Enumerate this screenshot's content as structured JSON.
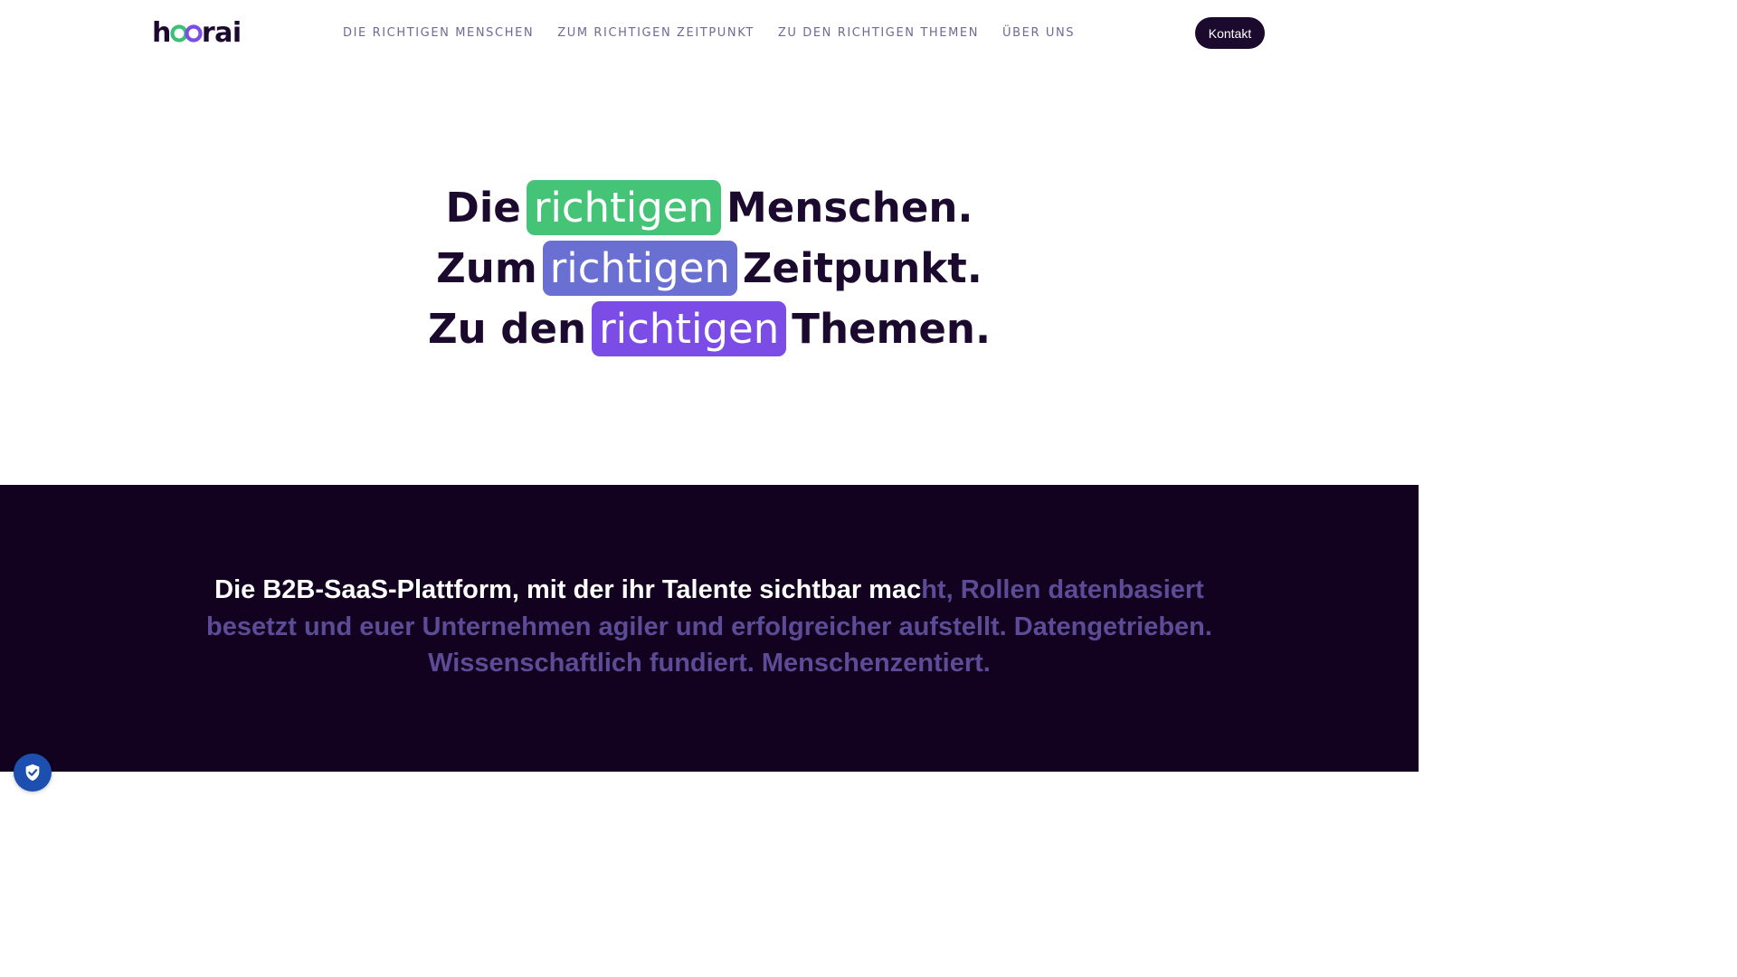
{
  "header": {
    "logo_text": "hoorai",
    "logo_colors": {
      "text": "#1b0a2e",
      "loop_green": "#3dbf78",
      "loop_purple": "#7b4de6"
    },
    "nav": [
      {
        "label": "DIE RICHTIGEN MENSCHEN"
      },
      {
        "label": "ZUM RICHTIGEN ZEITPUNKT"
      },
      {
        "label": "ZU DEN RICHTIGEN THEMEN"
      },
      {
        "label": "ÜBER UNS"
      }
    ],
    "cta_label": "Kontakt"
  },
  "hero": {
    "lines": [
      {
        "before": "Die",
        "highlight": "richtigen",
        "after": "Menschen.",
        "color": "#45c477"
      },
      {
        "before": "Zum",
        "highlight": "richtigen",
        "after": "Zeitpunkt.",
        "color": "#6a6fd2"
      },
      {
        "before": "Zu den",
        "highlight": "richtigen",
        "after": "Themen.",
        "color": "#7b4de6"
      }
    ]
  },
  "intro": {
    "lit_text": "Die B2B-SaaS-Plattform, mit der ihr Talente sichtbar mac",
    "dim_text": "ht, Rollen datenbasiert besetzt und euer Unternehmen agiler und erfolgreicher aufstellt. Datengetrieben. Wissenschaftlich fundiert. Menschenzentiert."
  },
  "privacy_widget": {
    "icon": "shield-check-icon"
  },
  "colors": {
    "dark_bg": "#12021f",
    "text_dark": "#1b0a2e",
    "nav_text": "#6f6a93",
    "dim_text": "#5c4b96",
    "privacy_blue": "#1c4fb0"
  }
}
